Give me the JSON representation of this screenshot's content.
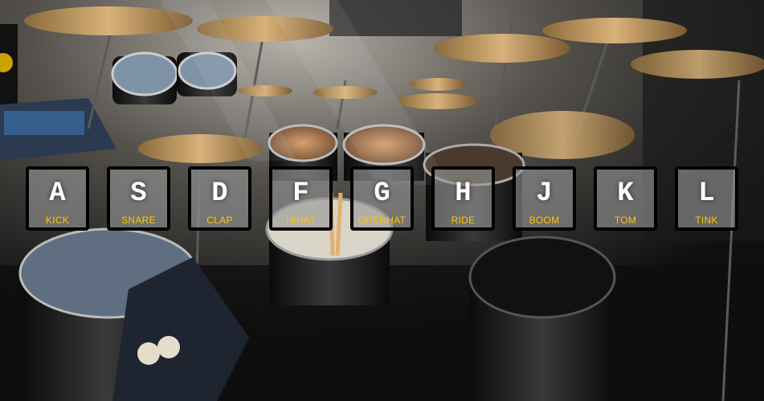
{
  "background": {
    "description_icon": "drum-kit-photo",
    "dominant_colors": [
      "#141414",
      "#c8a062",
      "#9a9a9a"
    ]
  },
  "accent_color": "#ffc600",
  "keys": [
    {
      "key": "A",
      "sound": "KICK"
    },
    {
      "key": "S",
      "sound": "SNARE"
    },
    {
      "key": "D",
      "sound": "CLAP"
    },
    {
      "key": "F",
      "sound": "HIHAT"
    },
    {
      "key": "G",
      "sound": "OPENHAT"
    },
    {
      "key": "H",
      "sound": "RIDE"
    },
    {
      "key": "J",
      "sound": "BOOM"
    },
    {
      "key": "K",
      "sound": "TOM"
    },
    {
      "key": "L",
      "sound": "TINK"
    }
  ]
}
